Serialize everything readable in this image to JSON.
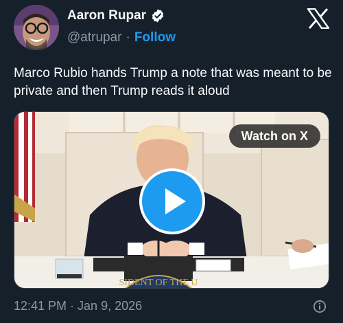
{
  "author": {
    "display_name": "Aaron Rupar",
    "handle": "@atrupar",
    "separator": "·",
    "follow_label": "Follow",
    "verified_icon": "verified-badge-icon"
  },
  "header": {
    "logo_icon": "x-logo-icon"
  },
  "tweet": {
    "text": "Marco Rubio hands Trump a note that was meant to be private and then Trump reads it aloud"
  },
  "media": {
    "watch_label": "Watch on X",
    "play_icon": "play-icon",
    "seal_text": "SIDENT OF THE U"
  },
  "footer": {
    "timestamp": "12:41 PM · Jan 9, 2026",
    "info_icon": "info-icon"
  },
  "colors": {
    "background": "#15202b",
    "accent": "#1d9bf0",
    "secondary_text": "#8b98a5",
    "primary_text": "#f7f9f9"
  }
}
